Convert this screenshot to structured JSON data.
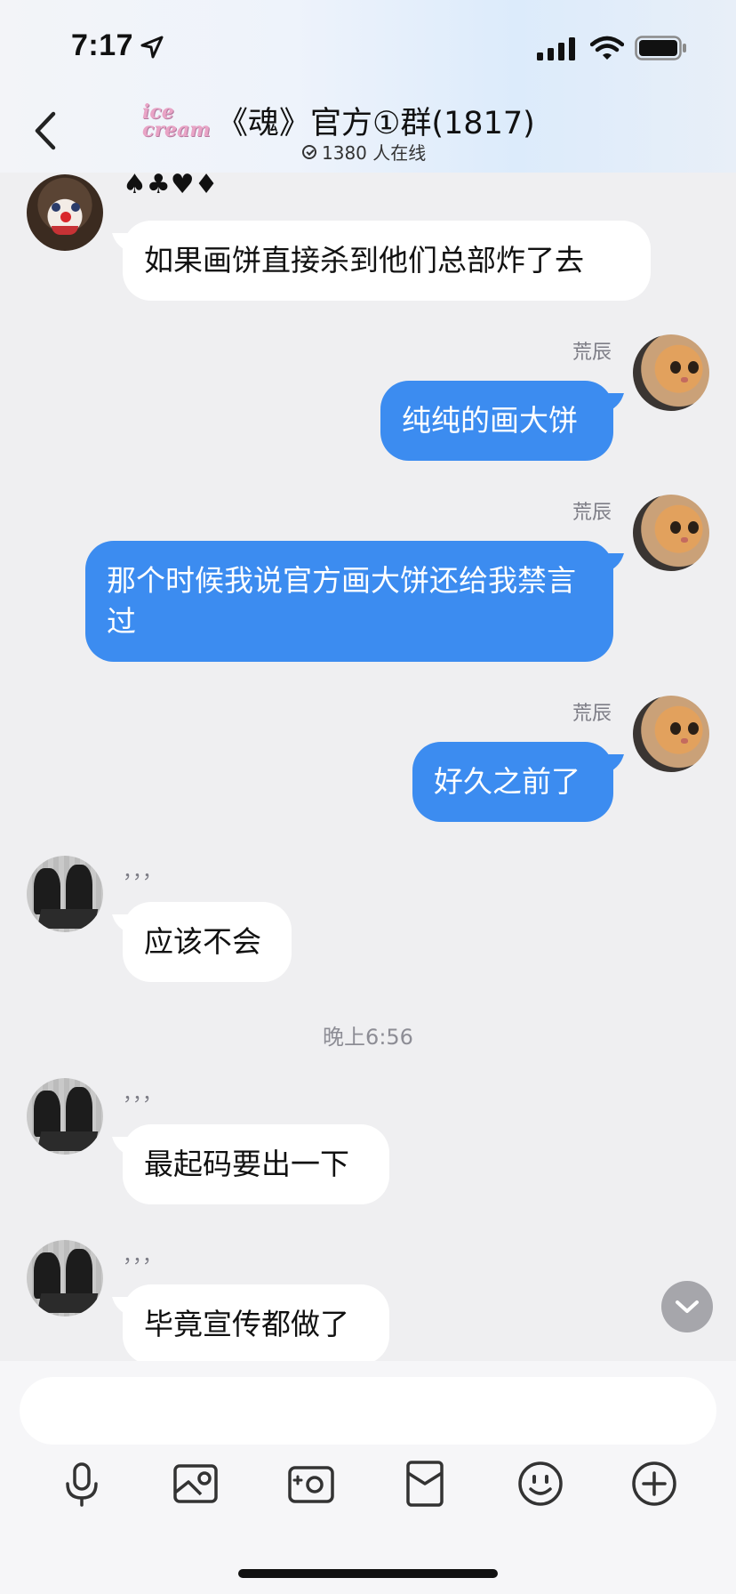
{
  "status_bar": {
    "time": "7:17"
  },
  "header": {
    "logo_text": "ice cream",
    "title": "《魂》官方①群(1817)",
    "online": "1380 人在线"
  },
  "messages": [
    {
      "side": "in",
      "sender": "♠♣♥♦",
      "text": "如果画饼直接杀到他们总部炸了去"
    },
    {
      "side": "out",
      "sender": "荒辰",
      "text": "纯纯的画大饼"
    },
    {
      "side": "out",
      "sender": "荒辰",
      "text": "那个时候我说官方画大饼还给我禁言过"
    },
    {
      "side": "out",
      "sender": "荒辰",
      "text": "好久之前了"
    },
    {
      "side": "in",
      "sender": "，，，",
      "text": "应该不会"
    },
    {
      "side": "in",
      "sender": "，，，",
      "text": "最起码要出一下"
    },
    {
      "side": "in",
      "sender": "，，，",
      "text": "毕竟宣传都做了"
    }
  ],
  "timestamp": "晚上6:56",
  "input": {
    "value": "",
    "placeholder": ""
  },
  "toolbar": [
    "microphone-icon",
    "image-icon",
    "camera-icon",
    "red-packet-icon",
    "emoji-icon",
    "plus-icon"
  ],
  "colors": {
    "out_bubble": "#3c8cf0",
    "in_bubble": "#ffffff",
    "background": "#efeff1"
  }
}
